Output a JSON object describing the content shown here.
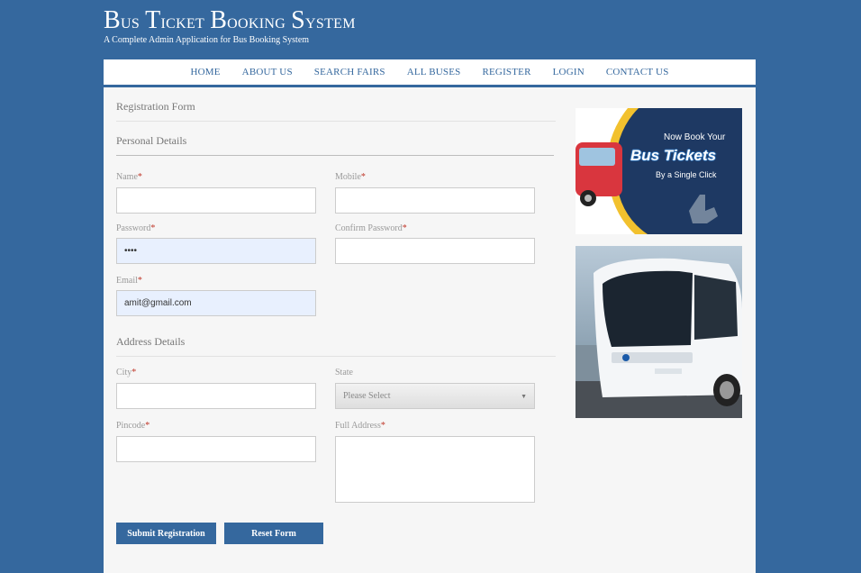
{
  "header": {
    "title_word1_cap": "B",
    "title_word1_rest": "us",
    "title_word2_cap": "T",
    "title_word2_rest": "icket",
    "title_word3_cap": "B",
    "title_word3_rest": "ooking",
    "title_word4_cap": "S",
    "title_word4_rest": "ystem",
    "subtitle": "A Complete Admin Application for Bus Booking System"
  },
  "nav": {
    "items": [
      {
        "label": "HOME"
      },
      {
        "label": "ABOUT US"
      },
      {
        "label": "SEARCH FAIRS"
      },
      {
        "label": "ALL BUSES"
      },
      {
        "label": "REGISTER"
      },
      {
        "label": "LOGIN"
      },
      {
        "label": "CONTACT US"
      }
    ]
  },
  "form": {
    "title": "Registration Form",
    "personal_section": "Personal Details",
    "address_section": "Address Details",
    "required_mark": "*",
    "fields": {
      "name": {
        "label": "Name",
        "value": ""
      },
      "mobile": {
        "label": "Mobile",
        "value": ""
      },
      "password": {
        "label": "Password",
        "value": "••••"
      },
      "confirm_password": {
        "label": "Confirm Password",
        "value": ""
      },
      "email": {
        "label": "Email",
        "value": "amit@gmail.com"
      },
      "city": {
        "label": "City",
        "value": ""
      },
      "state": {
        "label": "State",
        "selected": "Please Select"
      },
      "pincode": {
        "label": "Pincode",
        "value": ""
      },
      "full_address": {
        "label": "Full Address",
        "value": ""
      }
    },
    "submit_label": "Submit Registration",
    "reset_label": "Reset Form"
  },
  "banners": {
    "ad_line1": "Now Book Your",
    "ad_line2": "Bus Tickets",
    "ad_line3": "By a Single Click"
  },
  "colors": {
    "brand": "#35689e",
    "content_bg": "#f6f6f6",
    "autofill_bg": "#e8f0fe",
    "required": "#c0392b"
  }
}
